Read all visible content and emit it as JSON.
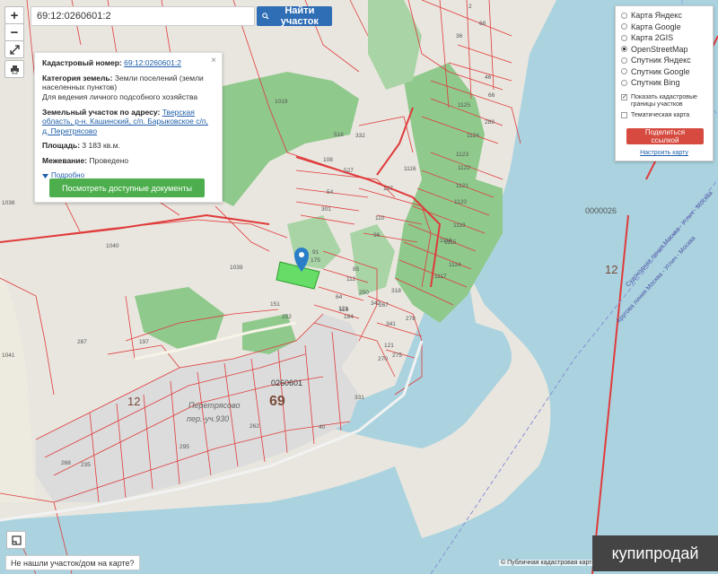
{
  "search": {
    "value": "69:12:0260601:2",
    "button_label": "Найти участок"
  },
  "zoom": {
    "in": "+",
    "out": "−"
  },
  "info": {
    "cad_label": "Кадастровый номер:",
    "cad_value": "69:12:0260601:2",
    "cat_label": "Категория земель:",
    "cat_value": "Земли поселений (земли населенных пунктов)",
    "use_value": "Для ведения личного подсобного хозяйства",
    "addr_label": "Земельный участок по адресу:",
    "addr_value": "Тверская область, р-н. Кашинский, с/п. Барыковское с/п, д. Перетрясово",
    "area_label": "Площадь:",
    "area_value": "3 183 кв.м.",
    "survey_label": "Межевание:",
    "survey_value": "Проведено",
    "more": "Подробно",
    "docs_button": "Посмотреть доступные документы",
    "close": "×"
  },
  "layers": {
    "items": [
      {
        "label": "Карта Яндекс",
        "selected": false
      },
      {
        "label": "Карта Google",
        "selected": false
      },
      {
        "label": "Карта 2GIS",
        "selected": false
      },
      {
        "label": "OpenStreetMap",
        "selected": true
      },
      {
        "label": "Спутник Яндекс",
        "selected": false
      },
      {
        "label": "Спутник Google",
        "selected": false
      },
      {
        "label": "Спутник Bing",
        "selected": false
      }
    ],
    "show_cad_borders": "Показать кадастровые границы участков",
    "show_cad_borders_checked": true,
    "thematic_map": "Тематическая карта",
    "thematic_map_checked": false,
    "share_button": "Поделиться ссылкой",
    "settings_link": "Настроить карту"
  },
  "map_labels": {
    "block": "0260601",
    "district": "69",
    "quarter": "12",
    "river_no": "12",
    "water_no": "0000026",
    "settlement": "Перетрясово",
    "street": "пер.-уч.930",
    "parcels": [
      "1036",
      "1040",
      "1039",
      "1041",
      "287",
      "197",
      "202",
      "151",
      "1019",
      "516",
      "332",
      "527",
      "54",
      "301",
      "91",
      "175",
      "85",
      "112",
      "64",
      "121",
      "184",
      "250",
      "267",
      "318",
      "1116",
      "1125",
      "1124",
      "1123",
      "1122",
      "1121",
      "1120",
      "1119",
      "1118",
      "1117",
      "1114",
      "1115",
      "108",
      "110",
      "127",
      "96",
      "2",
      "36",
      "46",
      "66",
      "68",
      "40",
      "331",
      "119",
      "121",
      "270",
      "275",
      "278",
      "342",
      "341",
      "262",
      "268",
      "235",
      "295",
      "289",
      "34",
      "1135"
    ],
    "ship_route_1": "Судоходная линия Москва - Углич - Москва",
    "ship_route_2": "Кругова линия Москва - Углич - Москва"
  },
  "not_found": "Не нашли участок/дом на карте?",
  "copyright": "© Публичная кадастровая карта",
  "watermark": "купипродай",
  "colors": {
    "water": "#aad3df",
    "forest": "#8fc98c",
    "land": "#e9e6df",
    "boundary": "#e03b3b",
    "selected": "#66dd66",
    "marker": "#2a7ec8"
  }
}
